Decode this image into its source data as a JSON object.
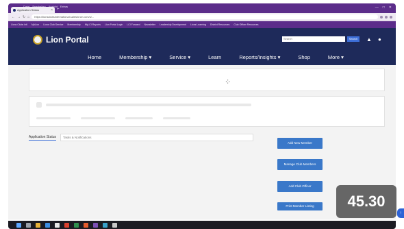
{
  "browser": {
    "menu": [
      "Datei",
      "Bearbeiten",
      "Ansicht",
      "Extras"
    ],
    "tab_title": "Application Status",
    "url": "https://lionsclubsinternational.salesforce.com/s/...",
    "window_controls": [
      "—",
      "□",
      "✕"
    ],
    "bookmarks": [
      "Lions Clubs Intl",
      "MyLion",
      "Lions Club Service",
      "Membership",
      "MyLCI Reports",
      "Lion Portal Login",
      "LCI Forward",
      "Newsletter",
      "Leadership Development",
      "Lions Learning",
      "District Resources",
      "Club Officer Resources"
    ]
  },
  "portal": {
    "logo_text": "Lion Portal",
    "search_placeholder": "Search",
    "search_button": "Search",
    "nav": [
      "Home",
      "Membership ▾",
      "Service ▾",
      "Learn",
      "Reports/Insights ▾",
      "Shop",
      "More ▾"
    ]
  },
  "content": {
    "tab_label": "Application Status",
    "tab_input_placeholder": "Tasks & Notifications",
    "buttons": [
      "Add New Member",
      "Manage Club Members",
      "Add Club Officer",
      "Print Member Listing"
    ]
  },
  "overlay": {
    "timestamp": "45.30"
  },
  "colors": {
    "chrome_purple": "#5b2c8a",
    "portal_navy": "#1e2a5a",
    "button_blue": "#3a78c9"
  }
}
